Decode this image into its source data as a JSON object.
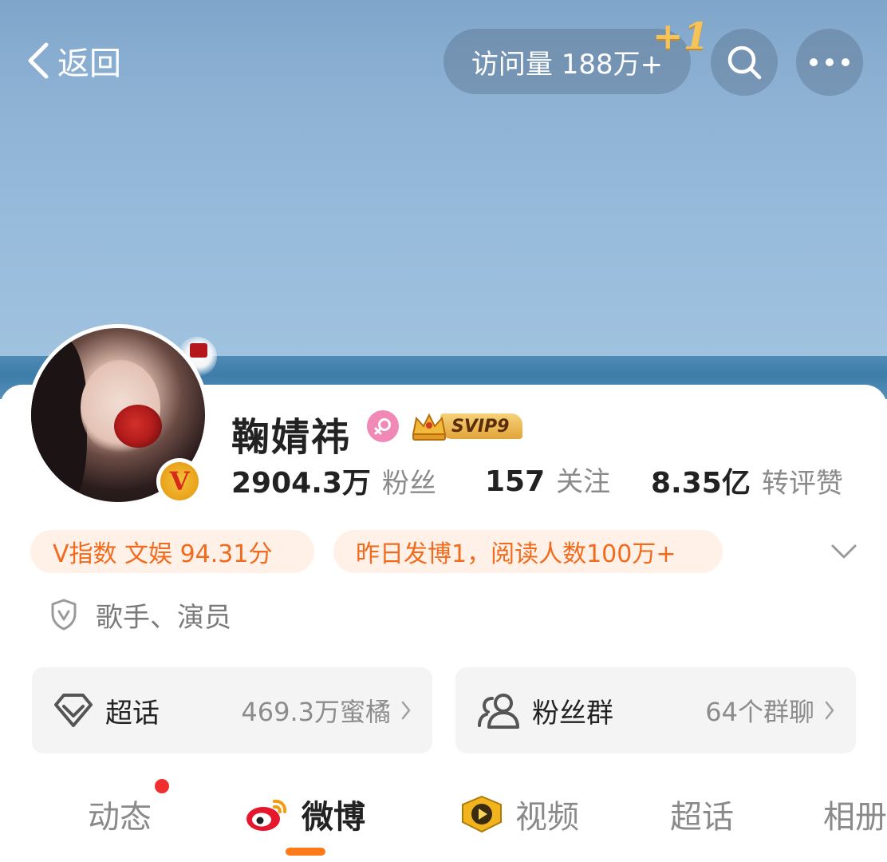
{
  "nav": {
    "back_label": "返回",
    "visits": "访问量 188万+",
    "visits_increment": "+1"
  },
  "profile": {
    "name": "鞠婧祎",
    "vip_level": "SVIP9",
    "followers_num": "2904.3万",
    "followers_label": "粉丝",
    "following_num": "157",
    "following_label": "关注",
    "interactions_num": "8.35亿",
    "interactions_label": "转评赞"
  },
  "pills": {
    "v_index": "V指数 文娱 94.31分",
    "post_stats": "昨日发博1，阅读人数100万+"
  },
  "verification": "歌手、演员",
  "tiles": {
    "super": {
      "title": "超话",
      "sub": "469.3万蜜橘"
    },
    "fans": {
      "title": "粉丝群",
      "sub": "64个群聊"
    }
  },
  "tabs": [
    {
      "label": "动态"
    },
    {
      "label": "微博"
    },
    {
      "label": "视频"
    },
    {
      "label": "超话"
    },
    {
      "label": "相册"
    }
  ],
  "colors": {
    "accent": "#ff7a1a",
    "pill_bg": "#fff0e8",
    "pill_text": "#f26b1d",
    "badge_red": "#f0302e",
    "gender_pink": "#f189b6"
  }
}
